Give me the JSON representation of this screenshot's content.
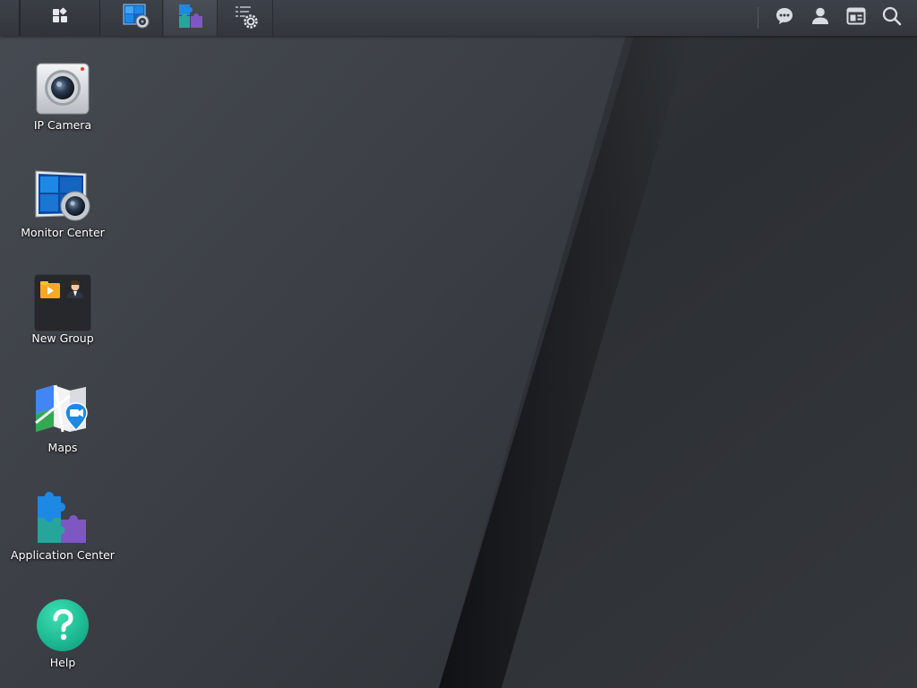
{
  "taskbar": {
    "main_menu_icon": "grid-icon",
    "open_apps": [
      {
        "name": "Monitor Center",
        "icon": "monitor-center-icon",
        "active": false
      },
      {
        "name": "Application Center",
        "icon": "application-center-icon",
        "active": true
      },
      {
        "name": "Package Settings",
        "icon": "settings-list-icon",
        "active": false
      }
    ],
    "tray_icons": [
      "chat-icon",
      "user-icon",
      "widgets-icon",
      "search-icon"
    ]
  },
  "desktop": {
    "icons": [
      {
        "label": "IP Camera",
        "icon": "ip-camera-icon"
      },
      {
        "label": "Monitor Center",
        "icon": "monitor-center-icon"
      },
      {
        "label": "New Group",
        "icon": "group-folder-icon"
      },
      {
        "label": "Maps",
        "icon": "maps-icon"
      },
      {
        "label": "Application Center",
        "icon": "application-center-icon"
      },
      {
        "label": "Help",
        "icon": "help-icon"
      }
    ]
  },
  "colors": {
    "taskbar_bg": "#363a40",
    "wallpaper_dark": "#25282c",
    "wallpaper_light": "#43474e",
    "help_green": "#1fc59a",
    "accent_blue": "#1e88e5"
  }
}
